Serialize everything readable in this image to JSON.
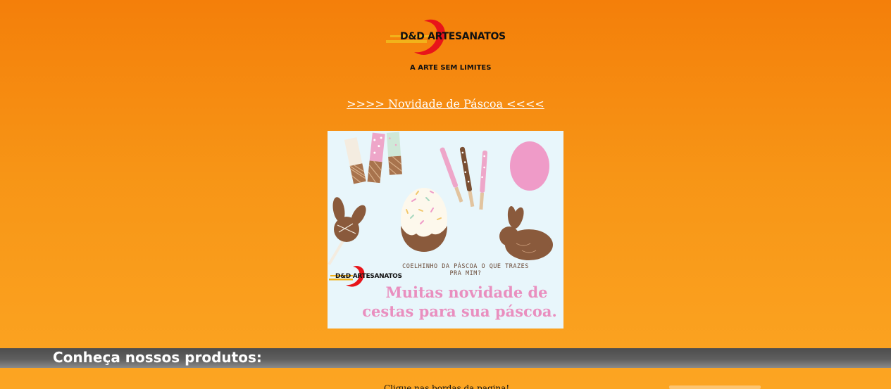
{
  "brand": {
    "name": "D&D ARTESANATOS",
    "tagline": "A ARTE SEM LIMITES"
  },
  "easter_link": {
    "label": ">>>> Novidade de Páscoa <<<<"
  },
  "promo": {
    "logo_text": "D&D ARTESANATOS",
    "caption": "COELHINHO DA PÁSCOA O QUE TRAZES PRA MIM?",
    "headline_line1": "Muitas novidade de",
    "headline_line2": "cestas para sua páscoa."
  },
  "products_section": {
    "title": "Conheça nossos produtos:",
    "hint": "Clique nas bordas da pagina!"
  },
  "colors": {
    "background_top": "#f47f0a",
    "background_bottom": "#fca522",
    "logo_red": "#e8141a",
    "logo_yellow": "#f2b21a",
    "promo_background": "#e8f6fb",
    "headline_pink": "#e98fbf",
    "chocolate": "#8a5a3c"
  }
}
